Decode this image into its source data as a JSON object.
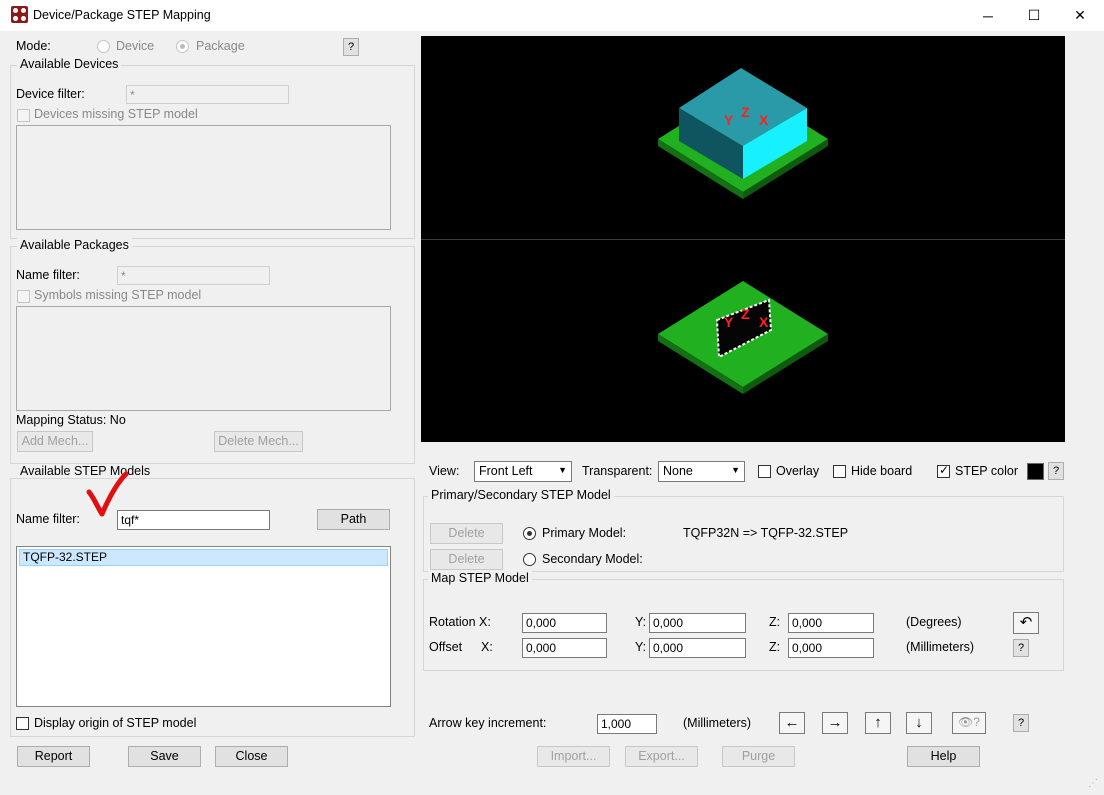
{
  "window": {
    "title": "Device/Package STEP Mapping",
    "minimize": "─",
    "maximize": "☐",
    "close": "✕"
  },
  "mode": {
    "label": "Mode:",
    "device": "Device",
    "package": "Package",
    "help": "?"
  },
  "devices": {
    "group_title": "Available Devices",
    "filter_label": "Device filter:",
    "filter_value": "*",
    "missing_label": "Devices missing STEP model"
  },
  "packages": {
    "group_title": "Available Packages",
    "filter_label": "Name filter:",
    "filter_value": "*",
    "missing_label": "Symbols missing STEP model",
    "mapping_status": "Mapping Status: No",
    "add_mech": "Add Mech...",
    "delete_mech": "Delete Mech..."
  },
  "step_models": {
    "group_title": "Available STEP Models",
    "filter_label": "Name filter:",
    "filter_value": "tqf*",
    "path_button": "Path",
    "items": [
      "TQFP-32.STEP"
    ],
    "display_origin": "Display origin of STEP model"
  },
  "view_controls": {
    "view_label": "View:",
    "view_value": "Front Left",
    "transparent_label": "Transparent:",
    "transparent_value": "None",
    "overlay": "Overlay",
    "hide_board": "Hide board",
    "step_color": "STEP color",
    "help": "?"
  },
  "primary_secondary": {
    "group_title": "Primary/Secondary STEP Model",
    "delete1": "Delete",
    "delete2": "Delete",
    "primary_label": "Primary Model:",
    "primary_value": "TQFP32N => TQFP-32.STEP",
    "secondary_label": "Secondary Model:"
  },
  "map_model": {
    "group_title": "Map STEP Model",
    "rotation_label": "Rotation X:",
    "offset_label": "Offset",
    "offset_x_label": "X:",
    "y_label": "Y:",
    "z_label": "Z:",
    "rot_x": "0,000",
    "rot_y": "0,000",
    "rot_z": "0,000",
    "off_x": "0,000",
    "off_y": "0,000",
    "off_z": "0,000",
    "degrees": "(Degrees)",
    "millimeters": "(Millimeters)",
    "help": "?"
  },
  "arrow_keys": {
    "label": "Arrow key increment:",
    "value": "1,000",
    "unit": "(Millimeters)",
    "help": "?"
  },
  "bottom": {
    "report": "Report",
    "save": "Save",
    "close": "Close",
    "import": "Import...",
    "export": "Export...",
    "purge": "Purge",
    "help": "Help"
  },
  "axes": {
    "x": "X",
    "y": "Y",
    "z": "Z"
  },
  "colors": {
    "viewport_bg": "#000000",
    "board_green": "#1aa01a",
    "chip_teal": "#2a9aa8",
    "axis_red": "#ff2020",
    "annotation_red": "#e01010"
  }
}
